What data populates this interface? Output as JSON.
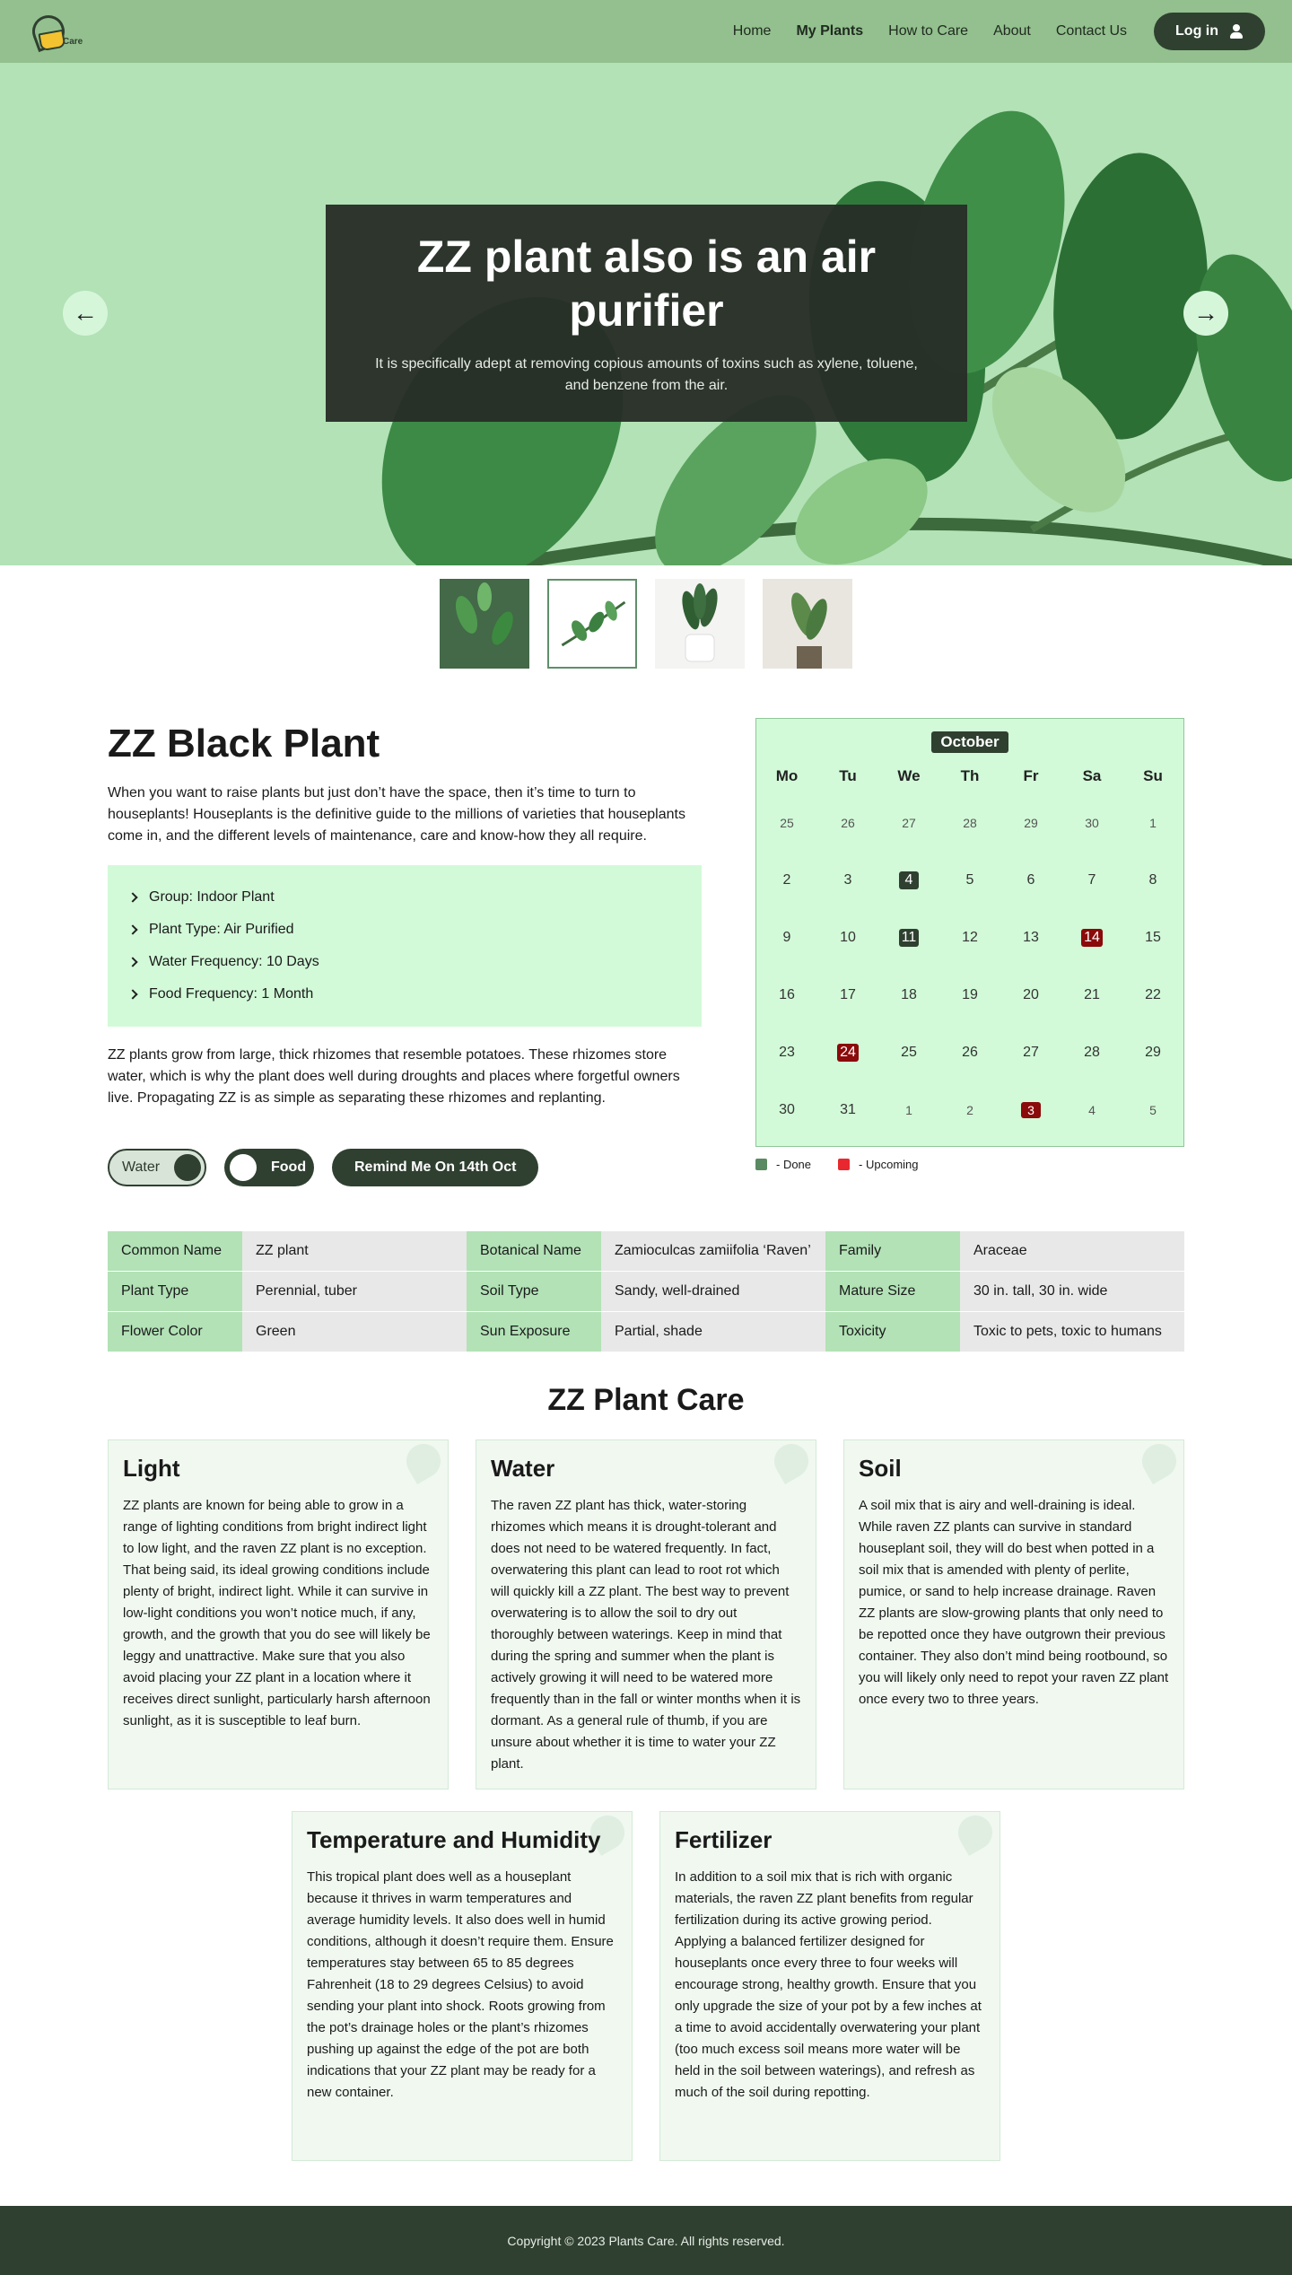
{
  "nav": {
    "logo_text": "Care",
    "links": [
      "Home",
      "My Plants",
      "How to Care",
      "About",
      "Contact Us"
    ],
    "login_label": "Log in",
    "bar_color": "#93c08e",
    "accent": "#2f4030"
  },
  "hero": {
    "title": "ZZ plant also is an air purifier",
    "subtitle": "It is specifically adept at removing copious amounts of toxins such as xylene, toluene, and benzene from the air.",
    "prev_icon": "arrow-left-icon",
    "next_icon": "arrow-right-icon",
    "active_slide": 2
  },
  "plant": {
    "title": "ZZ Black Plant",
    "intro": "When you want to raise plants but just don’t have the space, then it’s time to turn to houseplants! Houseplants is the definitive guide to the millions of varieties that houseplants come in, and the different levels of maintenance, care and know-how they all require.",
    "facts": [
      "Group: Indoor Plant",
      "Plant Type: Air Purified",
      "Water Frequency: 10 Days",
      "Food Frequency: 1 Month"
    ],
    "description": "ZZ plants grow from large, thick rhizomes that resemble potatoes. These rhizomes store water, which is why the plant does well during droughts and places where forgetful owners live. Propagating ZZ is as simple as separating these rhizomes and replanting.",
    "water_toggle": "Water",
    "food_toggle": "Food",
    "remind_label": "Remind Me On 14th Oct"
  },
  "calendar": {
    "month": "October",
    "weekdays": [
      "Mo",
      "Tu",
      "We",
      "Th",
      "Fr",
      "Sa",
      "Su"
    ],
    "days": [
      {
        "d": "25",
        "t": "other"
      },
      {
        "d": "26",
        "t": "other"
      },
      {
        "d": "27",
        "t": "other"
      },
      {
        "d": "28",
        "t": "other"
      },
      {
        "d": "29",
        "t": "other"
      },
      {
        "d": "30",
        "t": "other"
      },
      {
        "d": "1",
        "t": "other"
      },
      {
        "d": "2",
        "t": ""
      },
      {
        "d": "3",
        "t": ""
      },
      {
        "d": "4",
        "t": "done"
      },
      {
        "d": "5",
        "t": ""
      },
      {
        "d": "6",
        "t": ""
      },
      {
        "d": "7",
        "t": ""
      },
      {
        "d": "8",
        "t": ""
      },
      {
        "d": "9",
        "t": ""
      },
      {
        "d": "10",
        "t": ""
      },
      {
        "d": "11",
        "t": "done"
      },
      {
        "d": "12",
        "t": ""
      },
      {
        "d": "13",
        "t": ""
      },
      {
        "d": "14",
        "t": "up"
      },
      {
        "d": "15",
        "t": ""
      },
      {
        "d": "16",
        "t": ""
      },
      {
        "d": "17",
        "t": ""
      },
      {
        "d": "18",
        "t": ""
      },
      {
        "d": "19",
        "t": ""
      },
      {
        "d": "20",
        "t": ""
      },
      {
        "d": "21",
        "t": ""
      },
      {
        "d": "22",
        "t": ""
      },
      {
        "d": "23",
        "t": ""
      },
      {
        "d": "24",
        "t": "up"
      },
      {
        "d": "25",
        "t": ""
      },
      {
        "d": "26",
        "t": ""
      },
      {
        "d": "27",
        "t": ""
      },
      {
        "d": "28",
        "t": ""
      },
      {
        "d": "29",
        "t": ""
      },
      {
        "d": "30",
        "t": ""
      },
      {
        "d": "31",
        "t": ""
      },
      {
        "d": "1",
        "t": "other"
      },
      {
        "d": "2",
        "t": "other"
      },
      {
        "d": "3",
        "t": "up-other"
      },
      {
        "d": "4",
        "t": "other"
      },
      {
        "d": "5",
        "t": "other"
      }
    ],
    "legend_done": "- Done",
    "legend_upcoming": "- Upcoming",
    "done_color": "#5a8a62",
    "upcoming_color": "#e8282e"
  },
  "info_table": [
    [
      "Common Name",
      "ZZ plant",
      "Botanical Name",
      "Zamioculcas zamiifolia ‘Raven’",
      "Family",
      "Araceae"
    ],
    [
      "Plant Type",
      "Perennial, tuber",
      "Soil Type",
      "Sandy, well-drained",
      "Mature Size",
      "30 in. tall, 30 in. wide"
    ],
    [
      "Flower Color",
      "Green",
      "Sun Exposure",
      "Partial, shade",
      "Toxicity",
      "Toxic to pets, toxic to humans"
    ]
  ],
  "care": {
    "title": "ZZ Plant Care",
    "cards": [
      {
        "title": "Light",
        "text": "ZZ plants are known for being able to grow in a range of lighting conditions from bright indirect light to low light, and the raven ZZ plant is no exception. That being said, its ideal growing conditions include plenty of bright, indirect light. While it can survive in low-light conditions you won’t notice much, if any, growth, and the growth that you do see will likely be leggy and unattractive. Make sure that you also avoid placing your ZZ plant in a location where it receives direct sunlight, particularly harsh afternoon sunlight, as it is susceptible to leaf burn."
      },
      {
        "title": "Water",
        "text": "The raven ZZ plant has thick, water-storing rhizomes which means it is drought-tolerant and does not need to be watered frequently. In fact, overwatering this plant can lead to root rot which will quickly kill a ZZ plant. The best way to prevent overwatering is to allow the soil to dry out thoroughly between waterings. Keep in mind that during the spring and summer when the plant is actively growing it will need to be watered more frequently than in the fall or winter months when it is dormant. As a general rule of thumb, if you are unsure about whether it is time to water your ZZ plant."
      },
      {
        "title": "Soil",
        "text": "A soil mix that is airy and well-draining is ideal. While raven ZZ plants can survive in standard houseplant soil, they will do best when potted in a soil mix that is amended with plenty of perlite, pumice, or sand to help increase drainage. Raven ZZ plants are slow-growing plants that only need to be repotted once they have outgrown their previous container. They also don’t mind being rootbound, so you will likely only need to repot your raven ZZ plant once every two to three years."
      },
      {
        "title": "Temperature and Humidity",
        "text": "This tropical plant does well as a houseplant because it thrives in warm temperatures and average humidity levels. It also does well in humid conditions, although it doesn’t require them. Ensure temperatures stay between 65 to 85 degrees Fahrenheit (18 to 29 degrees Celsius) to avoid sending your plant into shock. Roots growing from the pot’s drainage holes or the plant’s rhizomes pushing up against the edge of the pot are both indications that your ZZ plant may be ready for a new container."
      },
      {
        "title": "Fertilizer",
        "text": "In addition to a soil mix that is rich with organic materials, the raven ZZ plant benefits from regular fertilization during its active growing period. Applying a balanced fertilizer designed for houseplants once every three to four weeks will encourage strong, healthy growth. Ensure that you only upgrade the size of your pot by a few inches at a time to avoid accidentally overwatering your plant (too much excess soil means more water will be held in the soil between waterings), and refresh as much of the soil during repotting."
      }
    ]
  },
  "footer": {
    "copyright": "Copyright © 2023 Plants Care. All rights reserved."
  }
}
